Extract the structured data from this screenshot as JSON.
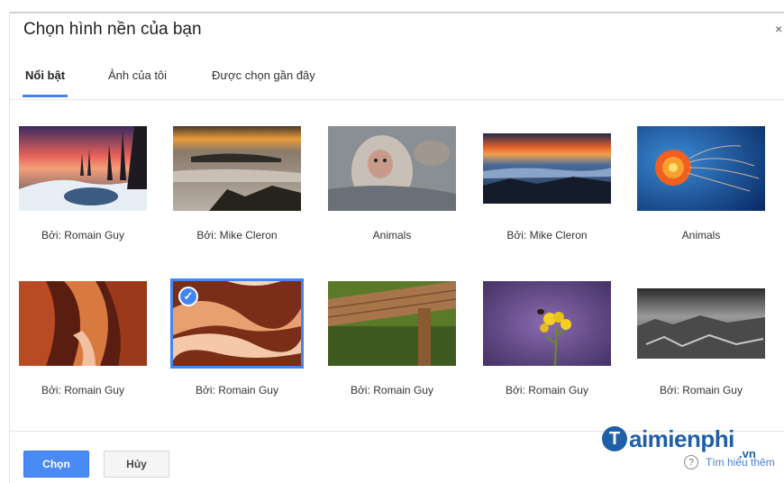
{
  "dialog": {
    "title": "Chọn hình nền của bạn",
    "close_glyph": "×"
  },
  "tabs": [
    {
      "label": "Nổi bật",
      "active": true
    },
    {
      "label": "Ảnh của tôi",
      "active": false
    },
    {
      "label": "Được chọn gần đây",
      "active": false
    }
  ],
  "wallpapers": [
    {
      "caption": "Bởi: Romain Guy",
      "scene": "sunset-frozen-lake",
      "selected": false
    },
    {
      "caption": "Bởi: Mike Cleron",
      "scene": "sunset-fog-valley",
      "selected": false
    },
    {
      "caption": "Animals",
      "scene": "snow-monkey",
      "selected": false
    },
    {
      "caption": "Bởi: Mike Cleron",
      "scene": "mountain-clouds-dusk",
      "selected": false
    },
    {
      "caption": "Animals",
      "scene": "orange-jellyfish",
      "selected": false
    },
    {
      "caption": "Bởi: Romain Guy",
      "scene": "slot-canyon-red",
      "selected": false
    },
    {
      "caption": "Bởi: Romain Guy",
      "scene": "slot-canyon-waves",
      "selected": true
    },
    {
      "caption": "Bởi: Romain Guy",
      "scene": "wooden-bench-closeup",
      "selected": false
    },
    {
      "caption": "Bởi: Romain Guy",
      "scene": "yellow-flower-bee",
      "selected": false
    },
    {
      "caption": "Bởi: Romain Guy",
      "scene": "black-white-landscape",
      "selected": false
    }
  ],
  "footer": {
    "select_label": "Chọn",
    "cancel_label": "Hủy",
    "help_label": "Tìm hiểu thêm",
    "help_icon_glyph": "?"
  },
  "watermark": {
    "logo_letter": "T",
    "word": "aimienphi",
    "suffix": ".vn"
  },
  "colors": {
    "accent": "#4285f4",
    "button_primary": "#4a8af4",
    "watermark": "#1e5fa8"
  }
}
